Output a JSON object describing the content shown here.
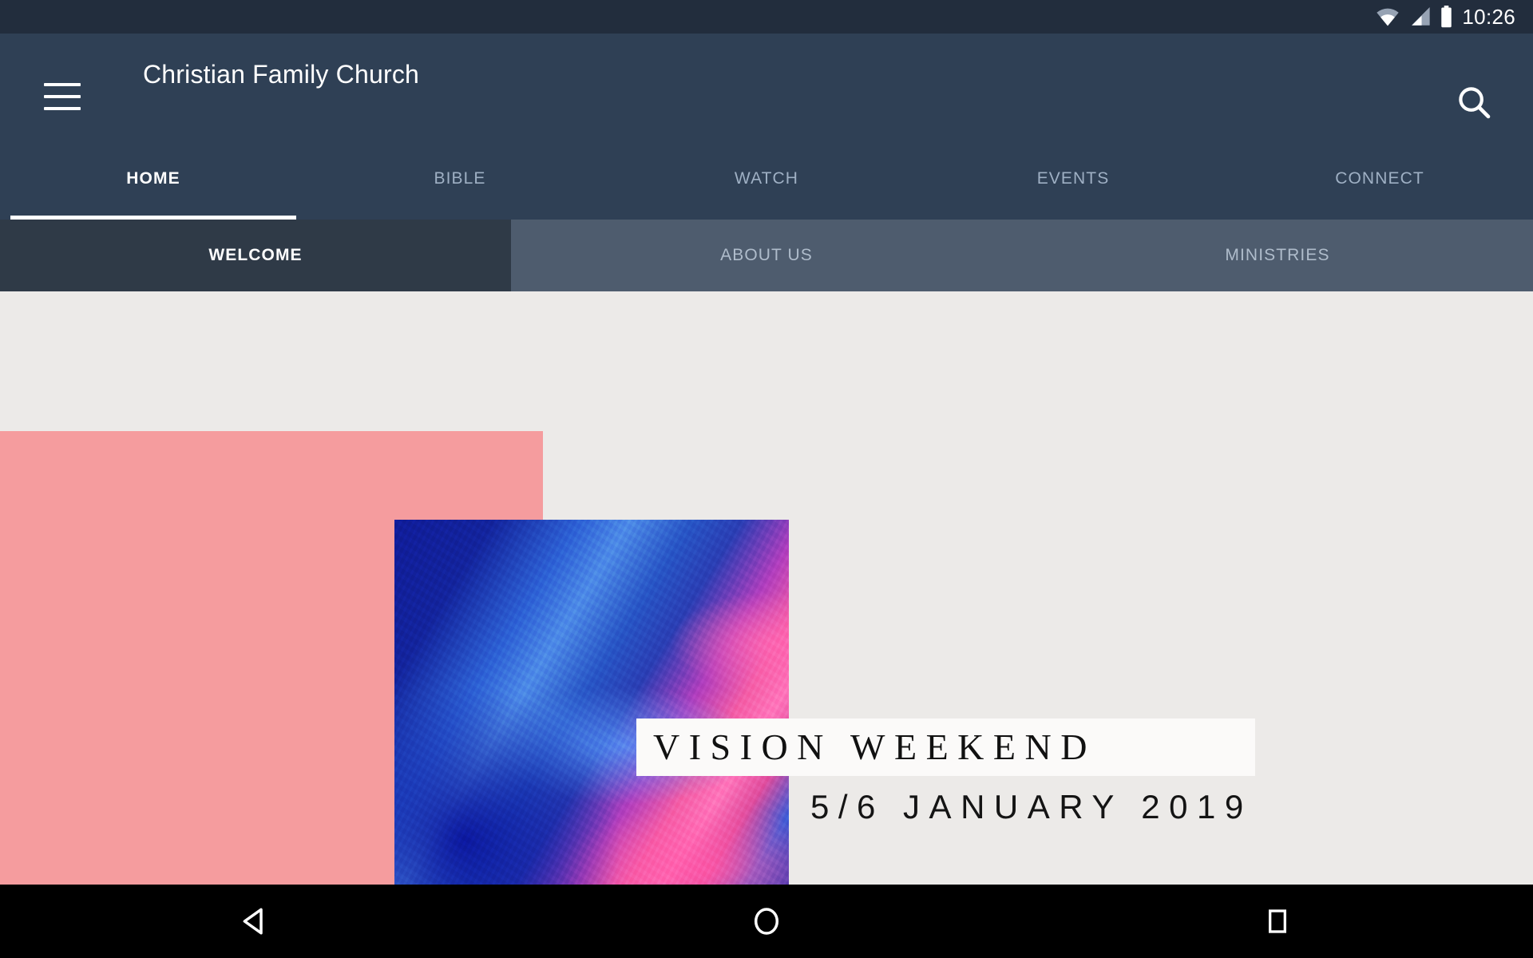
{
  "status_bar": {
    "wifi_icon": "wifi-icon",
    "signal_icon": "cellular-signal-icon",
    "battery_icon": "battery-full-icon",
    "time": "10:26"
  },
  "app_bar": {
    "menu_icon": "hamburger-menu-icon",
    "title": "Christian Family Church",
    "search_icon": "search-icon"
  },
  "primary_tabs": {
    "active_index": 0,
    "items": [
      {
        "label": "HOME"
      },
      {
        "label": "BIBLE"
      },
      {
        "label": "WATCH"
      },
      {
        "label": "EVENTS"
      },
      {
        "label": "CONNECT"
      }
    ]
  },
  "sub_tabs": {
    "active_index": 0,
    "items": [
      {
        "label": "WELCOME"
      },
      {
        "label": "ABOUT US"
      },
      {
        "label": "MINISTRIES"
      }
    ]
  },
  "content": {
    "promo": {
      "title": "VISION WEEKEND",
      "date": "5/6 JANUARY 2019",
      "pink_block_color": "#F59C9E",
      "background_color": "#ECEAE8",
      "title_block_color": "#FBFAF9",
      "photo_name": "vision-weekend-abstract-photo"
    }
  },
  "nav_bar": {
    "back_icon": "back-triangle-icon",
    "home_icon": "home-circle-icon",
    "recents_icon": "recents-square-icon"
  },
  "colors": {
    "app_bar": "#2F4055",
    "status_bar": "#222D3D",
    "subtab_active": "#2F3A47",
    "subtab_inactive": "#4E5C6E",
    "accent_underline": "#FFFFFF"
  }
}
